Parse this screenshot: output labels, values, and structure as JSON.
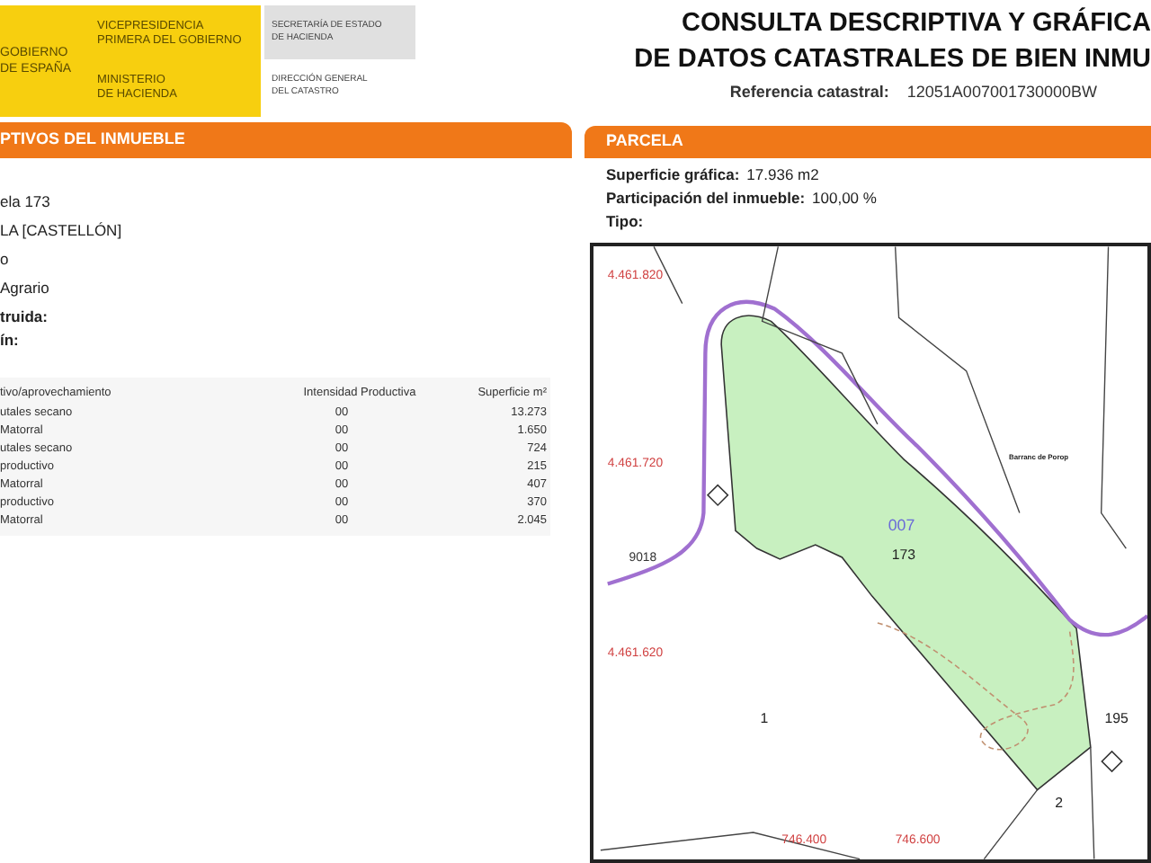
{
  "header": {
    "gobierno_lines": [
      "GOBIERNO",
      "DE ESPAÑA"
    ],
    "vicepresidencia_lines": [
      "VICEPRESIDENCIA",
      "PRIMERA DEL GOBIERNO"
    ],
    "ministerio_lines": [
      "MINISTERIO",
      "DE HACIENDA"
    ],
    "secretaria_lines": [
      "SECRETARÍA DE ESTADO",
      "DE HACIENDA"
    ],
    "direccion_lines": [
      "DIRECCIÓN GENERAL",
      "DEL CATASTRO"
    ],
    "title_lines": [
      "CONSULTA DESCRIPTIVA Y GRÁFICA",
      "DE DATOS CATASTRALES DE BIEN INMU"
    ],
    "referencia": {
      "label": "Referencia catastral:",
      "value": "12051A007001730000BW"
    }
  },
  "left_section": {
    "title": "PTIVOS DEL INMUEBLE",
    "lines": [
      {
        "text": "ela 173",
        "bold": false
      },
      {
        "text": "LA [CASTELLÓN]",
        "bold": false
      },
      {
        "text": "o",
        "bold": false
      },
      {
        "text": "Agrario",
        "bold": false
      },
      {
        "text": "truida:",
        "bold": true
      },
      {
        "text": "ín:",
        "bold": true
      }
    ],
    "table": {
      "columns": [
        "tivo/aprovechamiento",
        "Intensidad Productiva",
        "Superficie m²"
      ],
      "rows": [
        [
          "utales secano",
          "00",
          "13.273"
        ],
        [
          "Matorral",
          "00",
          "1.650"
        ],
        [
          "utales secano",
          "00",
          "724"
        ],
        [
          "productivo",
          "00",
          "215"
        ],
        [
          "Matorral",
          "00",
          "407"
        ],
        [
          "productivo",
          "00",
          "370"
        ],
        [
          "Matorral",
          "00",
          "2.045"
        ]
      ]
    }
  },
  "right_section": {
    "title": "PARCELA",
    "fields": [
      {
        "label": "Superficie gráfica:",
        "value": "17.936 m2"
      },
      {
        "label": "Participación del inmueble:",
        "value": "100,00 %"
      },
      {
        "label": "Tipo:"
      }
    ],
    "map": {
      "labels": [
        {
          "text": "4.461.820",
          "kind": "coordinate"
        },
        {
          "text": "4.461.720",
          "kind": "coordinate"
        },
        {
          "text": "4.461.620",
          "kind": "coordinate"
        },
        {
          "text": "746.400",
          "kind": "coordinate"
        },
        {
          "text": "746.600",
          "kind": "coordinate"
        },
        {
          "text": "Barranc de Porop",
          "kind": "place"
        },
        {
          "text": "007",
          "kind": "polygon"
        },
        {
          "text": "173",
          "kind": "parcel"
        },
        {
          "text": "9018",
          "kind": "road"
        },
        {
          "text": "1",
          "kind": "parcel"
        },
        {
          "text": "2",
          "kind": "parcel"
        },
        {
          "text": "195",
          "kind": "parcel"
        }
      ]
    }
  }
}
